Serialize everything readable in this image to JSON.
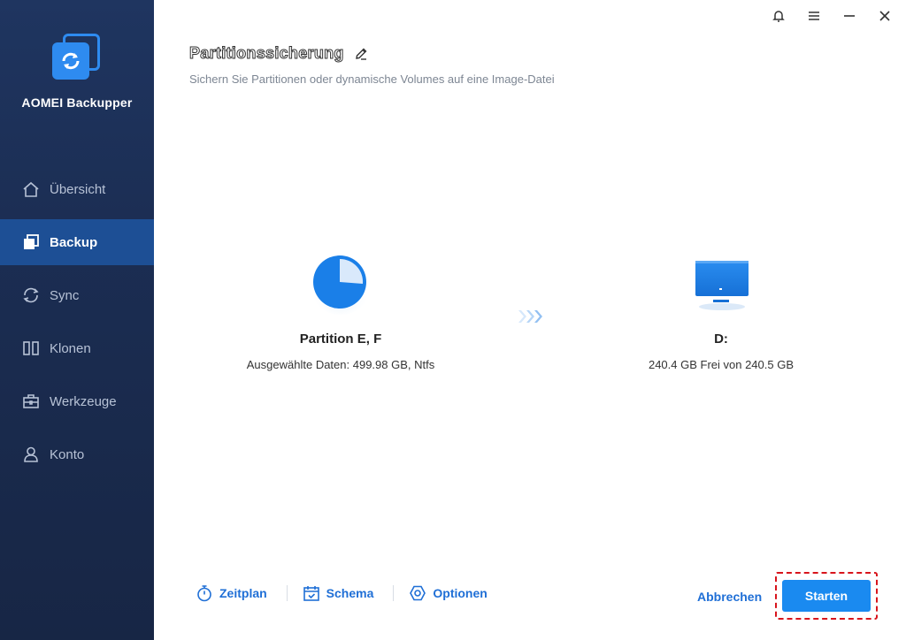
{
  "app": {
    "name": "AOMEI Backupper"
  },
  "sidebar": {
    "items": [
      {
        "label": "Übersicht",
        "icon": "home-icon",
        "active": false
      },
      {
        "label": "Backup",
        "icon": "backup-icon",
        "active": true
      },
      {
        "label": "Sync",
        "icon": "sync-icon",
        "active": false
      },
      {
        "label": "Klonen",
        "icon": "clone-icon",
        "active": false
      },
      {
        "label": "Werkzeuge",
        "icon": "toolbox-icon",
        "active": false
      },
      {
        "label": "Konto",
        "icon": "user-icon",
        "active": false
      }
    ]
  },
  "window": {
    "controls": [
      "bell-icon",
      "menu-icon",
      "minimize-icon",
      "close-icon"
    ]
  },
  "header": {
    "title": "Partitionssicherung",
    "subtitle": "Sichern Sie Partitionen oder dynamische Volumes auf eine Image-Datei"
  },
  "source": {
    "name": "Partition E, F",
    "info": "Ausgewählte Daten: 499.98 GB, Ntfs",
    "icon": "partition-pie-icon"
  },
  "target": {
    "name": "D:",
    "info": "240.4 GB Frei von 240.5 GB",
    "icon": "monitor-icon"
  },
  "footer": {
    "schedule": "Zeitplan",
    "scheme": "Schema",
    "options": "Optionen",
    "cancel": "Abbrechen",
    "start": "Starten"
  },
  "colors": {
    "accent": "#1a8af0",
    "sidebar": "#1b2d52",
    "sidebar_active": "#1d4f95",
    "highlight": "#d8141c"
  }
}
